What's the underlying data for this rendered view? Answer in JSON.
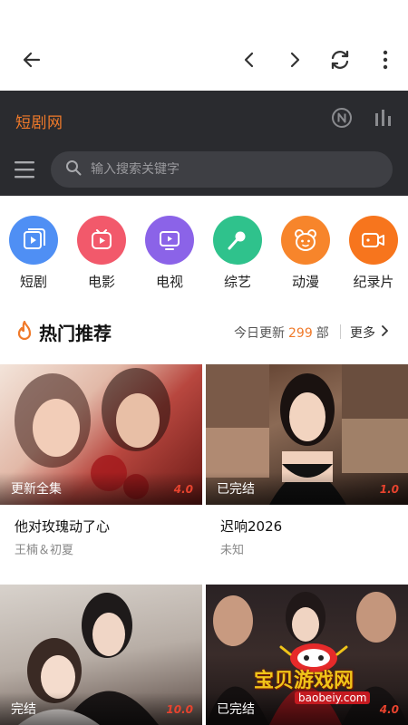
{
  "site": {
    "title": "短剧网"
  },
  "search": {
    "placeholder": "输入搜索关键字"
  },
  "categories": [
    {
      "label": "短剧",
      "color": "#4f8ff4",
      "icon": "video-icon"
    },
    {
      "label": "电影",
      "color": "#f2596b",
      "icon": "film-icon"
    },
    {
      "label": "电视",
      "color": "#8b63e8",
      "icon": "tv-icon"
    },
    {
      "label": "综艺",
      "color": "#2fc28c",
      "icon": "mic-icon"
    },
    {
      "label": "动漫",
      "color": "#f7852b",
      "icon": "anime-face-icon"
    },
    {
      "label": "纪录片",
      "color": "#f7751d",
      "icon": "camera-icon"
    }
  ],
  "section": {
    "title": "热门推荐",
    "update_prefix": "今日更新",
    "update_count": "299",
    "update_suffix": "部",
    "more": "更多"
  },
  "cards": [
    {
      "title": "他对玫瑰动了心",
      "subtitle": "王楠＆初夏",
      "badge": "更新全集",
      "score": "4.0"
    },
    {
      "title": "迟响2026",
      "subtitle": "未知",
      "badge": "已完结",
      "score": "1.0"
    },
    {
      "title": "",
      "subtitle": "",
      "badge": "完结",
      "score": "10.0"
    },
    {
      "title": "",
      "subtitle": "",
      "badge": "已完结",
      "score": "4.0"
    }
  ],
  "watermark": {
    "text": "宝贝游戏网",
    "url": "baobeiy.com"
  },
  "colors": {
    "accent": "#f07a2a",
    "header_bg": "#2a2b2f",
    "score": "#e8432e"
  }
}
